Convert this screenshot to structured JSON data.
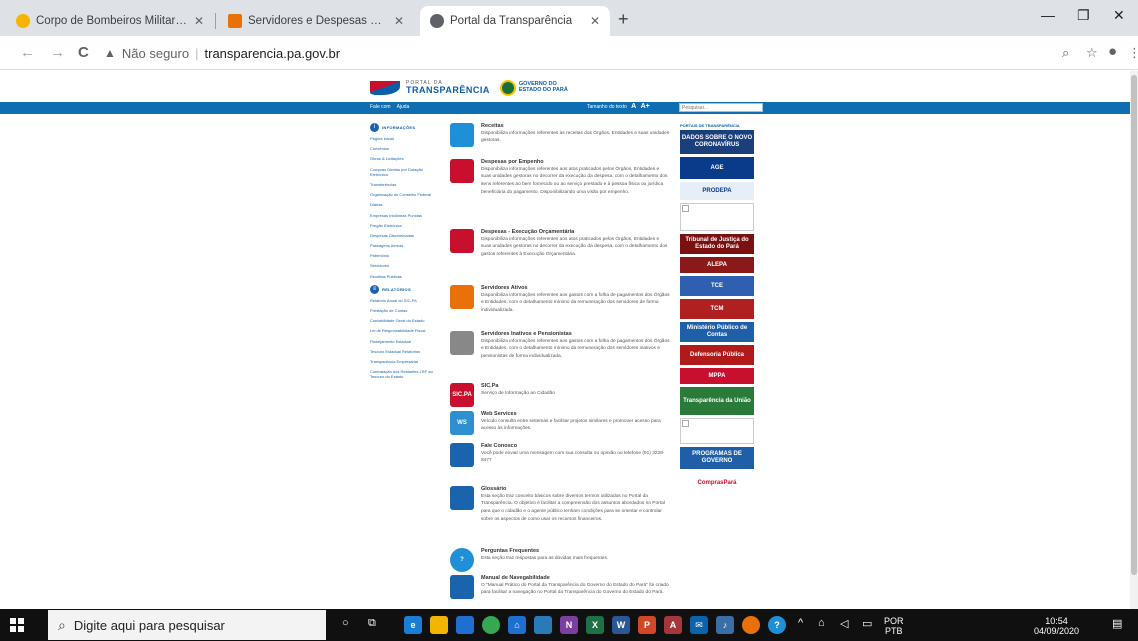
{
  "browser": {
    "tabs": [
      {
        "title": "Corpo de Bombeiros Militar do",
        "close": "✕",
        "favicon_color": "#f4b400"
      },
      {
        "title": "Servidores e Despesas – CODEC",
        "close": "✕",
        "favicon_color": "#e8710a"
      },
      {
        "title": "Portal da Transparência",
        "close": "✕",
        "favicon_color": "#5f6368"
      }
    ],
    "new_tab": "+",
    "window_controls": {
      "minimize": "—",
      "maximize": "❐",
      "close": "✕"
    },
    "nav": {
      "back": "←",
      "forward": "→",
      "reload": "C"
    },
    "address": {
      "warning_icon": "▲",
      "security_label": "Não seguro",
      "divider": "|",
      "url": "transparencia.pa.gov.br"
    },
    "toolbar_icons": {
      "zoom": "⌕",
      "bookmark": "☆",
      "profile": "●",
      "menu": "⋮"
    }
  },
  "site": {
    "logo": {
      "line1": "PORTAL DA",
      "line2": "TRANSPARÊNCIA"
    },
    "gov_logo": {
      "line1": "GOVERNO DO",
      "line2": "ESTADO DO PARÁ"
    },
    "topbar": {
      "links": [
        "Fale com",
        "Ajuda"
      ],
      "font_label": "Tamanho do texto",
      "font_a": "A",
      "font_a_plus": "A+",
      "search_placeholder": "Pesquisar..."
    },
    "leftnav": {
      "info_section": "INFORMAÇÕES",
      "info_items": [
        "Página Inicial",
        "Convênios",
        "Obras & Licitações",
        "Compras Diretas por Dotação Eletrônica",
        "Transferências",
        "Organização do Conselho Federal",
        "Diárias",
        "Empresas Inidôneas Punidas",
        "Pregão Eletrônico",
        "Despesas Discriminadas",
        "Passagens Aéreas",
        "Patrimônio",
        "Servidores",
        "Receitas Públicas"
      ],
      "reports_section": "RELATÓRIOS",
      "report_items": [
        "Relatório Anual do SIC-PA",
        "Prestação de Contas",
        "Contabilidade Geral do Estado",
        "Lei de Responsabilidade Fiscal",
        "Planejamento Estadual",
        "Tesouro Estadual Relatórios",
        "Transparência Empresarial",
        "Contratação dos Restantes LRF ao Tesouro do Estado"
      ]
    },
    "entries": [
      {
        "title": "Receitas",
        "desc": "Disponibiliza informações referentes às receitas dos Órgãos, Entidades e suas unidades gestoras.",
        "icon_color": "#1f8fd8"
      },
      {
        "title": "Despesas por Empenho",
        "desc": "Disponibiliza informações referentes aos atos praticados pelos Órgãos, Entidades e suas unidades gestoras no decorrer da execução da despesa, com o detalhamento dos itens referentes ao bem fornecido ou ao serviço prestado e à pessoa física ou jurídica beneficiária do pagamento. Disponibilizando uma visão por empenho.",
        "icon_color": "#c8102e"
      },
      {
        "title": "Despesas - Execução Orçamentária",
        "desc": "Disponibiliza informações referentes aos atos praticados pelos Órgãos, Entidades e suas unidades gestoras no decorrer da execução da despesa, com o detalhamento dos gastos referentes à Execução Orçamentária.",
        "icon_color": "#c8102e"
      },
      {
        "title": "Servidores Ativos",
        "desc": "Disponibiliza informações referentes aos gastos com a folha de pagamentos dos Órgãos e Entidades, com o detalhamento mínimo da remuneração dos servidores de forma individualizada.",
        "icon_color": "#e8710a"
      },
      {
        "title": "Servidores Inativos e Pensionistas",
        "desc": "Disponibiliza informações referentes aos gastos com a folha de pagamentos dos Órgãos e Entidades, com o detalhamento mínimo da remuneração dos servidores inativos e pensionistas de forma individualizada.",
        "icon_color": "#888888"
      },
      {
        "title": "SIC.Pa",
        "desc": "Serviço de Informação ao Cidadão",
        "icon_color": "#c8102e",
        "icon_text": "SIC.PA"
      },
      {
        "title": "Web Services",
        "desc": "Veículo consulta entre sistemas e facilitar projetos similares e promover acesso para acesso às informações.",
        "icon_color": "#2f8fd0",
        "icon_text": "WS"
      },
      {
        "title": "Fale Conosco",
        "desc": "Você pode enviar uma mensagem com sua consulta ou opinião ou telefone (91) 3228-8477",
        "icon_color": "#1a63ad"
      },
      {
        "title": "Glossário",
        "desc": "Esta seção traz conceito básicos sobre diversos termos utilizados no Portal da Transparência. O objetivo é facilitar a compreensão dos assuntos abordados no Portal para que o cidadão e o agente público tenham condições para se orientar e controlar sobre os aspectos de como usar os recursos financeiros.",
        "icon_color": "#1a63ad"
      },
      {
        "title": "Perguntas Frequentes",
        "desc": "Esta seção traz respostas para as dúvidas mais frequentes.",
        "icon_color": "#1f8fd8",
        "icon_text": "?"
      },
      {
        "title": "Manual de Navegabilidade",
        "desc": "O \"Manual Prático do Portal da Transparência do Governo do Estado do Pará\" foi criado para facilitar a navegação no Portal da Transparência do Governo do Estado do Pará.",
        "icon_color": "#1a63ad"
      }
    ],
    "right": {
      "header": "PORTAIS DE TRANSPARÊNCIA",
      "banners": [
        {
          "text": "DADOS SOBRE O NOVO CORONAVÍRUS",
          "bg": "#1a3f7a"
        },
        {
          "text": "AGE",
          "bg": "#0a3a8a"
        },
        {
          "text": "PRODEPA",
          "bg": "#e8eef7",
          "fg": "#0a3a8a"
        },
        {
          "text": "",
          "bg": "broken"
        },
        {
          "text": "Tribunal de Justiça do Estado do Pará",
          "bg": "#7a1010"
        },
        {
          "text": "ALEPA",
          "bg": "#8a1a1a"
        },
        {
          "text": "TCE",
          "bg": "#2f5fb0"
        },
        {
          "text": "TCM",
          "bg": "#b02020"
        },
        {
          "text": "Ministério Público de Contas",
          "bg": "#1f5fa8"
        },
        {
          "text": "Defensoria Pública",
          "bg": "#b01a1a"
        },
        {
          "text": "MPPA",
          "bg": "#c8102e"
        },
        {
          "text": "Transparência da União",
          "bg": "#2a7a3a"
        },
        {
          "text": "",
          "bg": "broken"
        },
        {
          "text": "PROGRAMAS DE GOVERNO",
          "bg": "#1f5fa8"
        },
        {
          "text": "ComprasPará",
          "bg": "#ffffff",
          "fg": "#c8102e"
        }
      ]
    }
  },
  "taskbar": {
    "search_placeholder": "Digite aqui para pesquisar",
    "language_line1": "POR",
    "language_line2": "PTB",
    "time": "10:54",
    "date": "04/09/2020"
  }
}
